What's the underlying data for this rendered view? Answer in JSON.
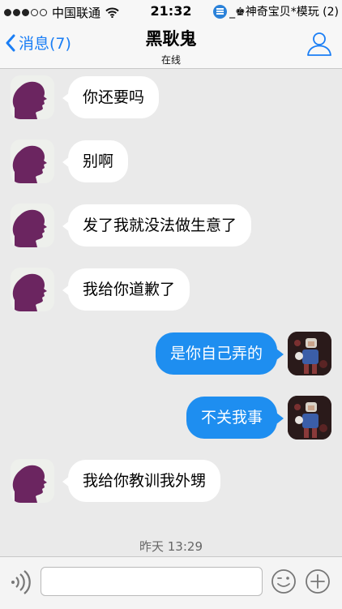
{
  "status_bar": {
    "carrier": "中国联通",
    "time": "21:32",
    "notification": "_♚神奇宝贝*模玩 (2)"
  },
  "nav": {
    "back_label": "消息(7)",
    "title": "黑耿鬼",
    "subtitle": "在线"
  },
  "messages": [
    {
      "from": "them",
      "text": "你还要吗"
    },
    {
      "from": "them",
      "text": "别啊"
    },
    {
      "from": "them",
      "text": "发了我就没法做生意了"
    },
    {
      "from": "them",
      "text": "我给你道歉了"
    },
    {
      "from": "me",
      "text": "是你自己弄的"
    },
    {
      "from": "me",
      "text": "不关我事"
    },
    {
      "from": "them",
      "text": "我给你教训我外甥"
    }
  ],
  "timestamp": "昨天 13:29",
  "colors": {
    "accent": "#1a7ef5",
    "my_bubble": "#1e8ef0",
    "their_bubble": "#ffffff",
    "background": "#eaeaea"
  },
  "icons": {
    "back": "chevron-left-icon",
    "profile": "person-icon",
    "voice": "voice-icon",
    "emoji": "emoji-icon",
    "plus": "plus-icon",
    "wifi": "wifi-icon"
  }
}
